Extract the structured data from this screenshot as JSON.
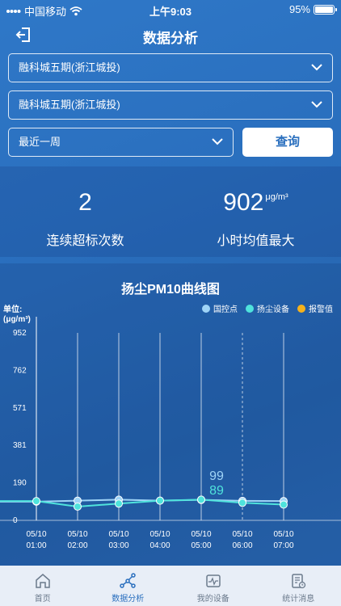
{
  "status_bar": {
    "carrier": "中国移动",
    "time": "上午9:03",
    "battery": "95%"
  },
  "header": {
    "title": "数据分析"
  },
  "filters": {
    "project": "融科城五期(浙江城投)",
    "device": "融科城五期(浙江城投)",
    "period": "最近一周",
    "query_label": "查询"
  },
  "stats": {
    "left": {
      "value": "2",
      "label": "连续超标次数"
    },
    "right": {
      "value": "902",
      "unit": "μg/m³",
      "label": "小时均值最大"
    }
  },
  "chart_data": {
    "type": "line",
    "title": "扬尘PM10曲线图",
    "unit_label": "单位:(μg/m³)",
    "legend": [
      {
        "name": "国控点",
        "color": "#9fd4f7"
      },
      {
        "name": "扬尘设备",
        "color": "#4fe3dc"
      },
      {
        "name": "报警值",
        "color": "#f5b21c"
      }
    ],
    "y_ticks": [
      "952",
      "762",
      "571",
      "381",
      "190",
      "0"
    ],
    "ylim": [
      0,
      952
    ],
    "x": [
      "05/10 01:00",
      "05/10 02:00",
      "05/10 03:00",
      "05/10 04:00",
      "05/10 05:00",
      "05/10 06:00",
      "05/10 07:00"
    ],
    "series": [
      {
        "name": "国控点",
        "color": "#9fd4f7",
        "values": [
          95,
          100,
          105,
          100,
          104,
          99,
          98
        ]
      },
      {
        "name": "扬尘设备",
        "color": "#4fe3dc",
        "values": [
          98,
          70,
          85,
          100,
          105,
          89,
          80
        ]
      }
    ],
    "annotation": {
      "index": 5,
      "values": [
        "99",
        "89"
      ]
    }
  },
  "tabs": [
    {
      "label": "首页",
      "icon": "home-icon"
    },
    {
      "label": "数据分析",
      "icon": "analysis-icon"
    },
    {
      "label": "我的设备",
      "icon": "device-icon"
    },
    {
      "label": "统计消息",
      "icon": "stats-message-icon"
    }
  ]
}
